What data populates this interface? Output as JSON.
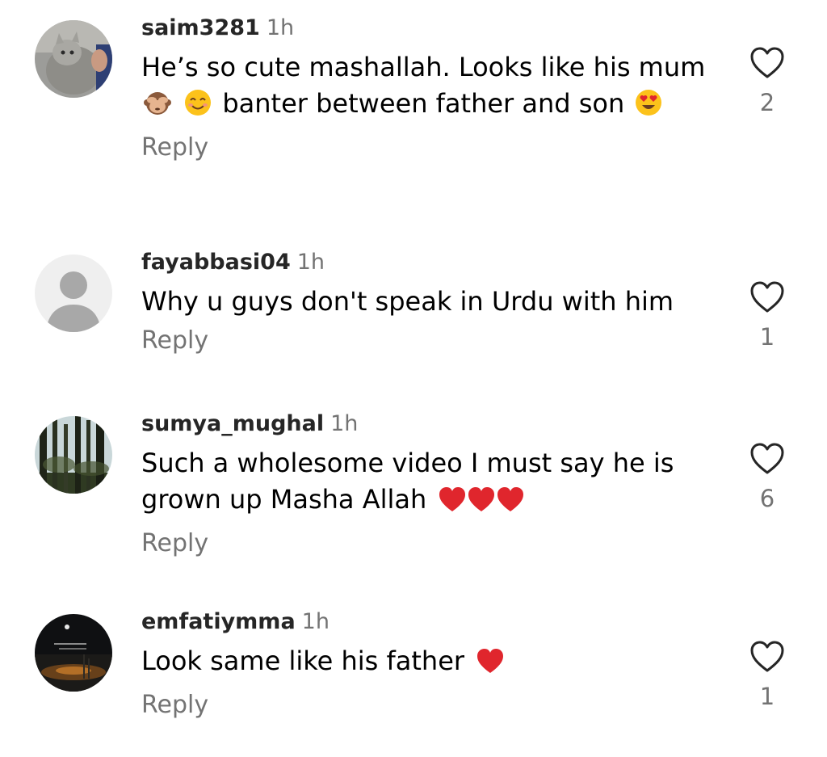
{
  "comments": [
    {
      "username": "saim3281",
      "time": "1h",
      "text_parts": [
        "He’s so cute mashallah. Looks like his mum",
        "banter between father and son"
      ],
      "emojis": [
        "see-no-evil-monkey",
        "smiling-face-with-smiling-eyes",
        "smiling-face-with-heart-eyes"
      ],
      "reply_label": "Reply",
      "likes": "2",
      "avatar": "kitten-photo"
    },
    {
      "username": "fayabbasi04",
      "time": "1h",
      "text_parts": [
        "Why u guys don't speak in Urdu with him"
      ],
      "emojis": [],
      "reply_label": "Reply",
      "likes": "1",
      "avatar": "default-person"
    },
    {
      "username": "sumya_mughal",
      "time": "1h",
      "text_parts": [
        "Such a wholesome video I must say he is grown up Masha Allah"
      ],
      "emojis": [
        "red-heart",
        "red-heart",
        "red-heart"
      ],
      "reply_label": "Reply",
      "likes": "6",
      "avatar": "forest-photo"
    },
    {
      "username": "emfatiymma",
      "time": "1h",
      "text_parts": [
        "Look same like his father"
      ],
      "emojis": [
        "red-heart"
      ],
      "reply_label": "Reply",
      "likes": "1",
      "avatar": "night-sky-photo"
    }
  ],
  "colors": {
    "username": "#262626",
    "secondary": "#737373",
    "text": "#000000",
    "heart_emoji": "#e0262d"
  }
}
